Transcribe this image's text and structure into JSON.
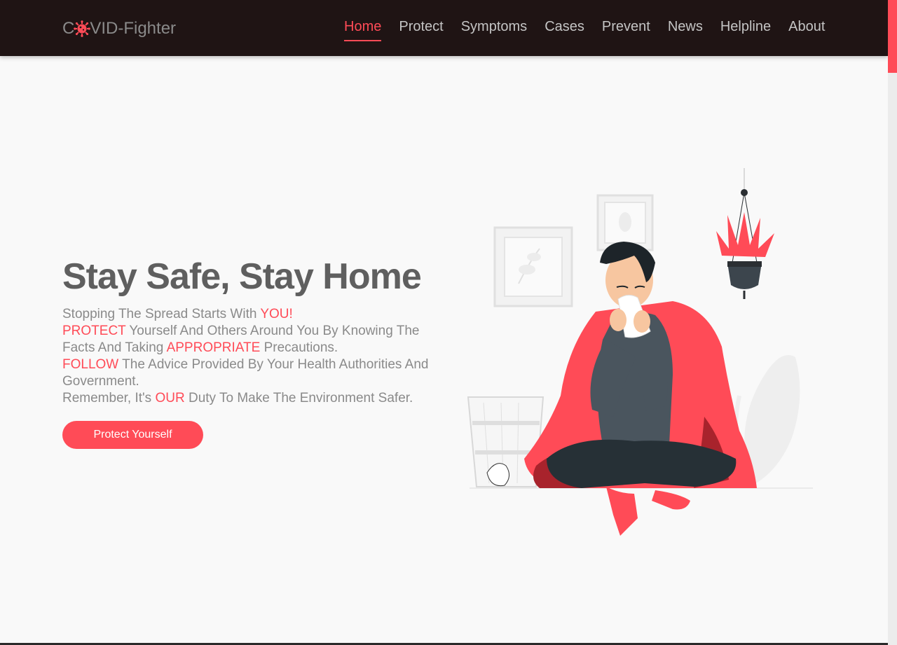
{
  "brand": {
    "prefix": "C",
    "suffix": "VID-Fighter"
  },
  "nav": {
    "home": "Home",
    "protect": "Protect",
    "symptoms": "Symptoms",
    "cases": "Cases",
    "prevent": "Prevent",
    "news": "News",
    "helpline": "Helpline",
    "about": "About"
  },
  "hero": {
    "title": "Stay Safe, Stay Home",
    "line1_a": "Stopping The Spread Starts With ",
    "line1_hl": "YOU!",
    "line2_hl": "PROTECT",
    "line2_a": " Yourself And Others Around You By Knowing The Facts And Taking ",
    "line2_hl2": "APPROPRIATE",
    "line2_b": " Precautions.",
    "line3_hl": "FOLLOW",
    "line3_a": " The Advice Provided By Your Health Authorities And Government.",
    "line4_a": "Remember, It's ",
    "line4_hl": "OUR",
    "line4_b": " Duty To Make The Environment Safer.",
    "button": "Protect Yourself"
  },
  "colors": {
    "accent": "#ff4b57",
    "navbar": "#1f1414",
    "background": "#f9f9f9",
    "text": "#8a8a8a",
    "title": "#5f5f5f"
  },
  "icons": {
    "brand_virus": "virus-icon"
  }
}
